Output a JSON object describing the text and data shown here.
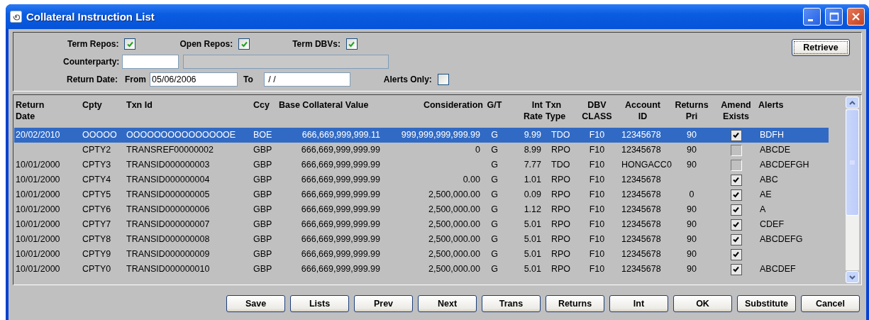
{
  "window": {
    "title": "Collateral Instruction List"
  },
  "filters": {
    "checkboxes": [
      {
        "label": "Term Repos:",
        "checked": true
      },
      {
        "label": "Open Repos:",
        "checked": true
      },
      {
        "label": "Term DBVs:",
        "checked": true
      }
    ],
    "counterparty": {
      "label": "Counterparty:",
      "name_field_disabled": true
    },
    "return_date": {
      "label": "Return Date:",
      "from_label": "From",
      "from_value": "05/06/2006",
      "to_label": "To",
      "to_value": " / /"
    },
    "alerts_only": {
      "label": "Alerts Only:",
      "checked": false
    },
    "retrieve_button": "Retrieve"
  },
  "table": {
    "columns": [
      {
        "lines": [
          "Return",
          "Date"
        ]
      },
      {
        "lines": [
          "Cpty"
        ]
      },
      {
        "lines": [
          "Txn Id"
        ]
      },
      {
        "lines": [
          "Ccy"
        ]
      },
      {
        "lines": [
          "Base Collateral Value"
        ]
      },
      {
        "lines": [
          "Consideration"
        ]
      },
      {
        "lines": [
          "G/T"
        ]
      },
      {
        "lines": [
          "Int",
          "Rate"
        ]
      },
      {
        "lines": [
          "Txn",
          "Type"
        ]
      },
      {
        "lines": [
          "DBV",
          "CLASS"
        ]
      },
      {
        "lines": [
          "Account",
          "ID"
        ]
      },
      {
        "lines": [
          "Returns",
          "Pri"
        ]
      },
      {
        "lines": [
          "Amend",
          "Exists"
        ]
      },
      {
        "lines": [
          "Alerts"
        ]
      }
    ],
    "rows": [
      {
        "selected": true,
        "return_date": "20/02/2010",
        "cpty": "OOOOO",
        "txn_id": "OOOOOOOOOOOOOOOE",
        "ccy": "BOE",
        "base_value": "666,669,999,999.11",
        "consideration": "999,999,999,999.99",
        "gt": "G",
        "int_rate": "9.99",
        "txn_type": "TDO",
        "dbv_class": "F10",
        "account_id": "12345678",
        "returns_pri": "90",
        "amend_exists": true,
        "alerts": "BDFH"
      },
      {
        "selected": false,
        "cpty": "CPTY2",
        "txn_id": "TRANSREF00000002",
        "ccy": "GBP",
        "base_value": "666,669,999,999.99",
        "consideration": "0",
        "gt": "G",
        "int_rate": "8.99",
        "txn_type": "RPO",
        "dbv_class": "F10",
        "account_id": "12345678",
        "returns_pri": "90",
        "amend_exists": false,
        "alerts": "ABCDE"
      },
      {
        "selected": false,
        "return_date": "10/01/2000",
        "cpty": "CPTY3",
        "txn_id": "TRANSID000000003",
        "ccy": "GBP",
        "base_value": "666,669,999,999.99",
        "gt": "G",
        "int_rate": "7.77",
        "txn_type": "TDO",
        "dbv_class": "F10",
        "account_id": "HONGACC0",
        "returns_pri": "90",
        "amend_exists": false,
        "alerts": "ABCDEFGH"
      },
      {
        "selected": false,
        "return_date": "10/01/2000",
        "cpty": "CPTY4",
        "txn_id": "TRANSID000000004",
        "ccy": "GBP",
        "base_value": "666,669,999,999.99",
        "consideration": "0.00",
        "gt": "G",
        "int_rate": "1.01",
        "txn_type": "RPO",
        "dbv_class": "F10",
        "account_id": "12345678",
        "amend_exists": true,
        "alerts": "ABC"
      },
      {
        "selected": false,
        "return_date": "10/01/2000",
        "cpty": "CPTY5",
        "txn_id": "TRANSID000000005",
        "ccy": "GBP",
        "base_value": "666,669,999,999.99",
        "consideration": "2,500,000.00",
        "gt": "G",
        "int_rate": "0.09",
        "txn_type": "RPO",
        "dbv_class": "F10",
        "account_id": "12345678",
        "returns_pri": "0",
        "amend_exists": true,
        "alerts": "AE"
      },
      {
        "selected": false,
        "return_date": "10/01/2000",
        "cpty": "CPTY6",
        "txn_id": "TRANSID000000006",
        "ccy": "GBP",
        "base_value": "666,669,999,999.99",
        "consideration": "2,500,000.00",
        "gt": "G",
        "int_rate": "1.12",
        "txn_type": "RPO",
        "dbv_class": "F10",
        "account_id": "12345678",
        "returns_pri": "90",
        "amend_exists": true,
        "alerts": "A"
      },
      {
        "selected": false,
        "return_date": "10/01/2000",
        "cpty": "CPTY7",
        "txn_id": "TRANSID000000007",
        "ccy": "GBP",
        "base_value": "666,669,999,999.99",
        "consideration": "2,500,000.00",
        "gt": "G",
        "int_rate": "5.01",
        "txn_type": "RPO",
        "dbv_class": "F10",
        "account_id": "12345678",
        "returns_pri": "90",
        "amend_exists": true,
        "alerts": "CDEF"
      },
      {
        "selected": false,
        "return_date": "10/01/2000",
        "cpty": "CPTY8",
        "txn_id": "TRANSID000000008",
        "ccy": "GBP",
        "base_value": "666,669,999,999.99",
        "consideration": "2,500,000.00",
        "gt": "G",
        "int_rate": "5.01",
        "txn_type": "RPO",
        "dbv_class": "F10",
        "account_id": "12345678",
        "returns_pri": "90",
        "amend_exists": true,
        "alerts": "ABCDEFG"
      },
      {
        "selected": false,
        "return_date": "10/01/2000",
        "cpty": "CPTY9",
        "txn_id": "TRANSID000000009",
        "ccy": "GBP",
        "base_value": "666,669,999,999.99",
        "consideration": "2,500,000.00",
        "gt": "G",
        "int_rate": "5.01",
        "txn_type": "RPO",
        "dbv_class": "F10",
        "account_id": "12345678",
        "returns_pri": "90",
        "amend_exists": true
      },
      {
        "selected": false,
        "return_date": "10/01/2000",
        "cpty": "CPTY0",
        "txn_id": "TRANSID000000010",
        "ccy": "GBP",
        "base_value": "666,669,999,999.99",
        "consideration": "2,500,000.00",
        "gt": "G",
        "int_rate": "5.01",
        "txn_type": "RPO",
        "dbv_class": "F10",
        "account_id": "12345678",
        "returns_pri": "90",
        "amend_exists": true,
        "alerts": "ABCDEF"
      }
    ]
  },
  "buttons": [
    "Save",
    "Lists",
    "Prev",
    "Next",
    "Trans",
    "Returns",
    "Int",
    "OK",
    "Substitute",
    "Cancel"
  ]
}
